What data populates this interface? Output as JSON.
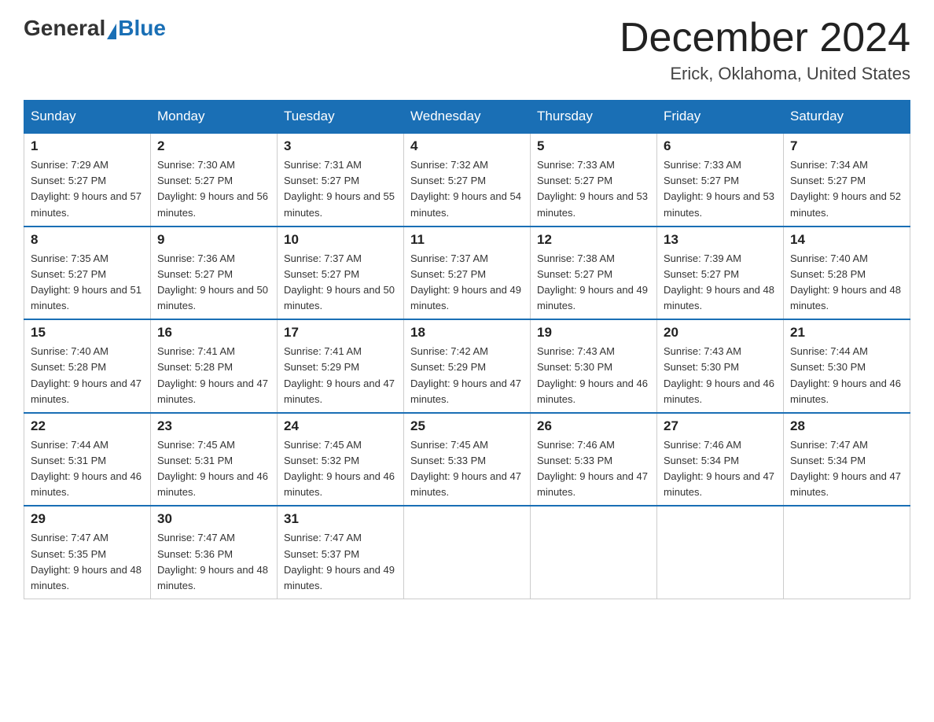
{
  "header": {
    "logo_general": "General",
    "logo_blue": "Blue",
    "month": "December 2024",
    "location": "Erick, Oklahoma, United States"
  },
  "weekdays": [
    "Sunday",
    "Monday",
    "Tuesday",
    "Wednesday",
    "Thursday",
    "Friday",
    "Saturday"
  ],
  "weeks": [
    [
      {
        "day": "1",
        "sunrise": "Sunrise: 7:29 AM",
        "sunset": "Sunset: 5:27 PM",
        "daylight": "Daylight: 9 hours and 57 minutes."
      },
      {
        "day": "2",
        "sunrise": "Sunrise: 7:30 AM",
        "sunset": "Sunset: 5:27 PM",
        "daylight": "Daylight: 9 hours and 56 minutes."
      },
      {
        "day": "3",
        "sunrise": "Sunrise: 7:31 AM",
        "sunset": "Sunset: 5:27 PM",
        "daylight": "Daylight: 9 hours and 55 minutes."
      },
      {
        "day": "4",
        "sunrise": "Sunrise: 7:32 AM",
        "sunset": "Sunset: 5:27 PM",
        "daylight": "Daylight: 9 hours and 54 minutes."
      },
      {
        "day": "5",
        "sunrise": "Sunrise: 7:33 AM",
        "sunset": "Sunset: 5:27 PM",
        "daylight": "Daylight: 9 hours and 53 minutes."
      },
      {
        "day": "6",
        "sunrise": "Sunrise: 7:33 AM",
        "sunset": "Sunset: 5:27 PM",
        "daylight": "Daylight: 9 hours and 53 minutes."
      },
      {
        "day": "7",
        "sunrise": "Sunrise: 7:34 AM",
        "sunset": "Sunset: 5:27 PM",
        "daylight": "Daylight: 9 hours and 52 minutes."
      }
    ],
    [
      {
        "day": "8",
        "sunrise": "Sunrise: 7:35 AM",
        "sunset": "Sunset: 5:27 PM",
        "daylight": "Daylight: 9 hours and 51 minutes."
      },
      {
        "day": "9",
        "sunrise": "Sunrise: 7:36 AM",
        "sunset": "Sunset: 5:27 PM",
        "daylight": "Daylight: 9 hours and 50 minutes."
      },
      {
        "day": "10",
        "sunrise": "Sunrise: 7:37 AM",
        "sunset": "Sunset: 5:27 PM",
        "daylight": "Daylight: 9 hours and 50 minutes."
      },
      {
        "day": "11",
        "sunrise": "Sunrise: 7:37 AM",
        "sunset": "Sunset: 5:27 PM",
        "daylight": "Daylight: 9 hours and 49 minutes."
      },
      {
        "day": "12",
        "sunrise": "Sunrise: 7:38 AM",
        "sunset": "Sunset: 5:27 PM",
        "daylight": "Daylight: 9 hours and 49 minutes."
      },
      {
        "day": "13",
        "sunrise": "Sunrise: 7:39 AM",
        "sunset": "Sunset: 5:27 PM",
        "daylight": "Daylight: 9 hours and 48 minutes."
      },
      {
        "day": "14",
        "sunrise": "Sunrise: 7:40 AM",
        "sunset": "Sunset: 5:28 PM",
        "daylight": "Daylight: 9 hours and 48 minutes."
      }
    ],
    [
      {
        "day": "15",
        "sunrise": "Sunrise: 7:40 AM",
        "sunset": "Sunset: 5:28 PM",
        "daylight": "Daylight: 9 hours and 47 minutes."
      },
      {
        "day": "16",
        "sunrise": "Sunrise: 7:41 AM",
        "sunset": "Sunset: 5:28 PM",
        "daylight": "Daylight: 9 hours and 47 minutes."
      },
      {
        "day": "17",
        "sunrise": "Sunrise: 7:41 AM",
        "sunset": "Sunset: 5:29 PM",
        "daylight": "Daylight: 9 hours and 47 minutes."
      },
      {
        "day": "18",
        "sunrise": "Sunrise: 7:42 AM",
        "sunset": "Sunset: 5:29 PM",
        "daylight": "Daylight: 9 hours and 47 minutes."
      },
      {
        "day": "19",
        "sunrise": "Sunrise: 7:43 AM",
        "sunset": "Sunset: 5:30 PM",
        "daylight": "Daylight: 9 hours and 46 minutes."
      },
      {
        "day": "20",
        "sunrise": "Sunrise: 7:43 AM",
        "sunset": "Sunset: 5:30 PM",
        "daylight": "Daylight: 9 hours and 46 minutes."
      },
      {
        "day": "21",
        "sunrise": "Sunrise: 7:44 AM",
        "sunset": "Sunset: 5:30 PM",
        "daylight": "Daylight: 9 hours and 46 minutes."
      }
    ],
    [
      {
        "day": "22",
        "sunrise": "Sunrise: 7:44 AM",
        "sunset": "Sunset: 5:31 PM",
        "daylight": "Daylight: 9 hours and 46 minutes."
      },
      {
        "day": "23",
        "sunrise": "Sunrise: 7:45 AM",
        "sunset": "Sunset: 5:31 PM",
        "daylight": "Daylight: 9 hours and 46 minutes."
      },
      {
        "day": "24",
        "sunrise": "Sunrise: 7:45 AM",
        "sunset": "Sunset: 5:32 PM",
        "daylight": "Daylight: 9 hours and 46 minutes."
      },
      {
        "day": "25",
        "sunrise": "Sunrise: 7:45 AM",
        "sunset": "Sunset: 5:33 PM",
        "daylight": "Daylight: 9 hours and 47 minutes."
      },
      {
        "day": "26",
        "sunrise": "Sunrise: 7:46 AM",
        "sunset": "Sunset: 5:33 PM",
        "daylight": "Daylight: 9 hours and 47 minutes."
      },
      {
        "day": "27",
        "sunrise": "Sunrise: 7:46 AM",
        "sunset": "Sunset: 5:34 PM",
        "daylight": "Daylight: 9 hours and 47 minutes."
      },
      {
        "day": "28",
        "sunrise": "Sunrise: 7:47 AM",
        "sunset": "Sunset: 5:34 PM",
        "daylight": "Daylight: 9 hours and 47 minutes."
      }
    ],
    [
      {
        "day": "29",
        "sunrise": "Sunrise: 7:47 AM",
        "sunset": "Sunset: 5:35 PM",
        "daylight": "Daylight: 9 hours and 48 minutes."
      },
      {
        "day": "30",
        "sunrise": "Sunrise: 7:47 AM",
        "sunset": "Sunset: 5:36 PM",
        "daylight": "Daylight: 9 hours and 48 minutes."
      },
      {
        "day": "31",
        "sunrise": "Sunrise: 7:47 AM",
        "sunset": "Sunset: 5:37 PM",
        "daylight": "Daylight: 9 hours and 49 minutes."
      },
      null,
      null,
      null,
      null
    ]
  ]
}
